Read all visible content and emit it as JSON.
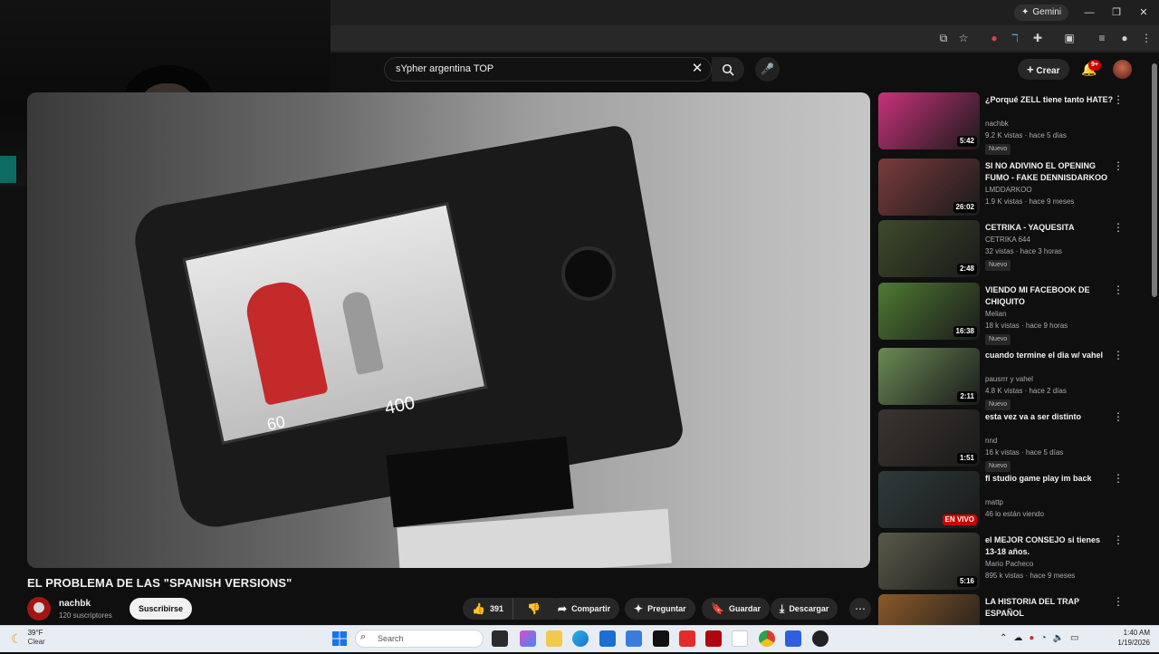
{
  "browser": {
    "gemini_label": "Gemini",
    "window_controls": [
      "minimize-icon",
      "restore-icon",
      "close-icon"
    ]
  },
  "header": {
    "search_value": "sYpher argentina TOP",
    "create_label": "Crear",
    "notifications_badge": "9+"
  },
  "video": {
    "title": "EL PROBLEMA DE LAS \"SPANISH VERSIONS\"",
    "iso_text": "400",
    "shutter_text": "60",
    "channel": {
      "name": "nachbk",
      "subscribers": "120 suscriptores",
      "subscribe_label": "Suscribirse"
    },
    "actions": {
      "likes": "391",
      "share_label": "Compartir",
      "ask_label": "Preguntar",
      "save_label": "Guardar",
      "download_label": "Descargar"
    }
  },
  "recommendations": [
    {
      "title": "¿Porqué ZELL tiene tanto HATE?",
      "channel": "nachbk",
      "meta": "9.2 K vistas · hace 5 días",
      "duration": "5:42",
      "badge": "Nuevo",
      "thumb_color": "#c8327a"
    },
    {
      "title": "SI NO ADIVINO EL OPENING FUMO - FAKE DENNISDARKOO",
      "channel": "LMDDARKOO",
      "meta": "1.9 K vistas · hace 9 meses",
      "duration": "26:02",
      "badge": "",
      "thumb_color": "#7a3b3b"
    },
    {
      "title": "CETRIKA - YAQUESITA",
      "channel": "CETRIKA 644",
      "meta": "32 vistas · hace 3 horas",
      "duration": "2:48",
      "badge": "Nuevo",
      "thumb_color": "#3d4a2a"
    },
    {
      "title": "VIENDO MI FACEBOOK DE CHIQUITO",
      "channel": "Melian",
      "meta": "18 k vistas · hace 9 horas",
      "duration": "16:38",
      "badge": "Nuevo",
      "thumb_color": "#4f7a33"
    },
    {
      "title": "cuando termine el dia w/ vahel",
      "channel": "pausrrr y vahel",
      "meta": "4.8 K vistas · hace 2 días",
      "duration": "2:11",
      "badge": "Nuevo",
      "thumb_color": "#6a8a55"
    },
    {
      "title": "esta vez va a ser distinto",
      "channel": "nnd",
      "meta": "16 k vistas · hace 5 días",
      "duration": "1:51",
      "badge": "Nuevo",
      "thumb_color": "#3a3430"
    },
    {
      "title": "fl studio game play im back",
      "channel": "mattp",
      "meta": "46 lo están viendo",
      "duration": "",
      "live": "EN VIVO",
      "badge": "",
      "thumb_color": "#2d3b3a"
    },
    {
      "title": "el MEJOR CONSEJO si tienes 13-18 años.",
      "channel": "Mario Pacheco",
      "meta": "895 k vistas · hace 9 meses",
      "duration": "5:16",
      "badge": "",
      "thumb_color": "#5a5a4a"
    },
    {
      "title": "LA HISTORIA DEL TRAP ESPAÑOL",
      "channel": "",
      "meta": "",
      "duration": "",
      "badge": "",
      "thumb_color": "#8a5a2a"
    }
  ],
  "taskbar": {
    "temperature": "39°F",
    "condition": "Clear",
    "search_placeholder": "Search",
    "time": "1:40 AM",
    "date": "1/19/2026"
  },
  "colors": {
    "youtube_bg": "#0f0f0f",
    "accent_red": "#cc0000",
    "taskbar_bg": "#e8edf3"
  }
}
